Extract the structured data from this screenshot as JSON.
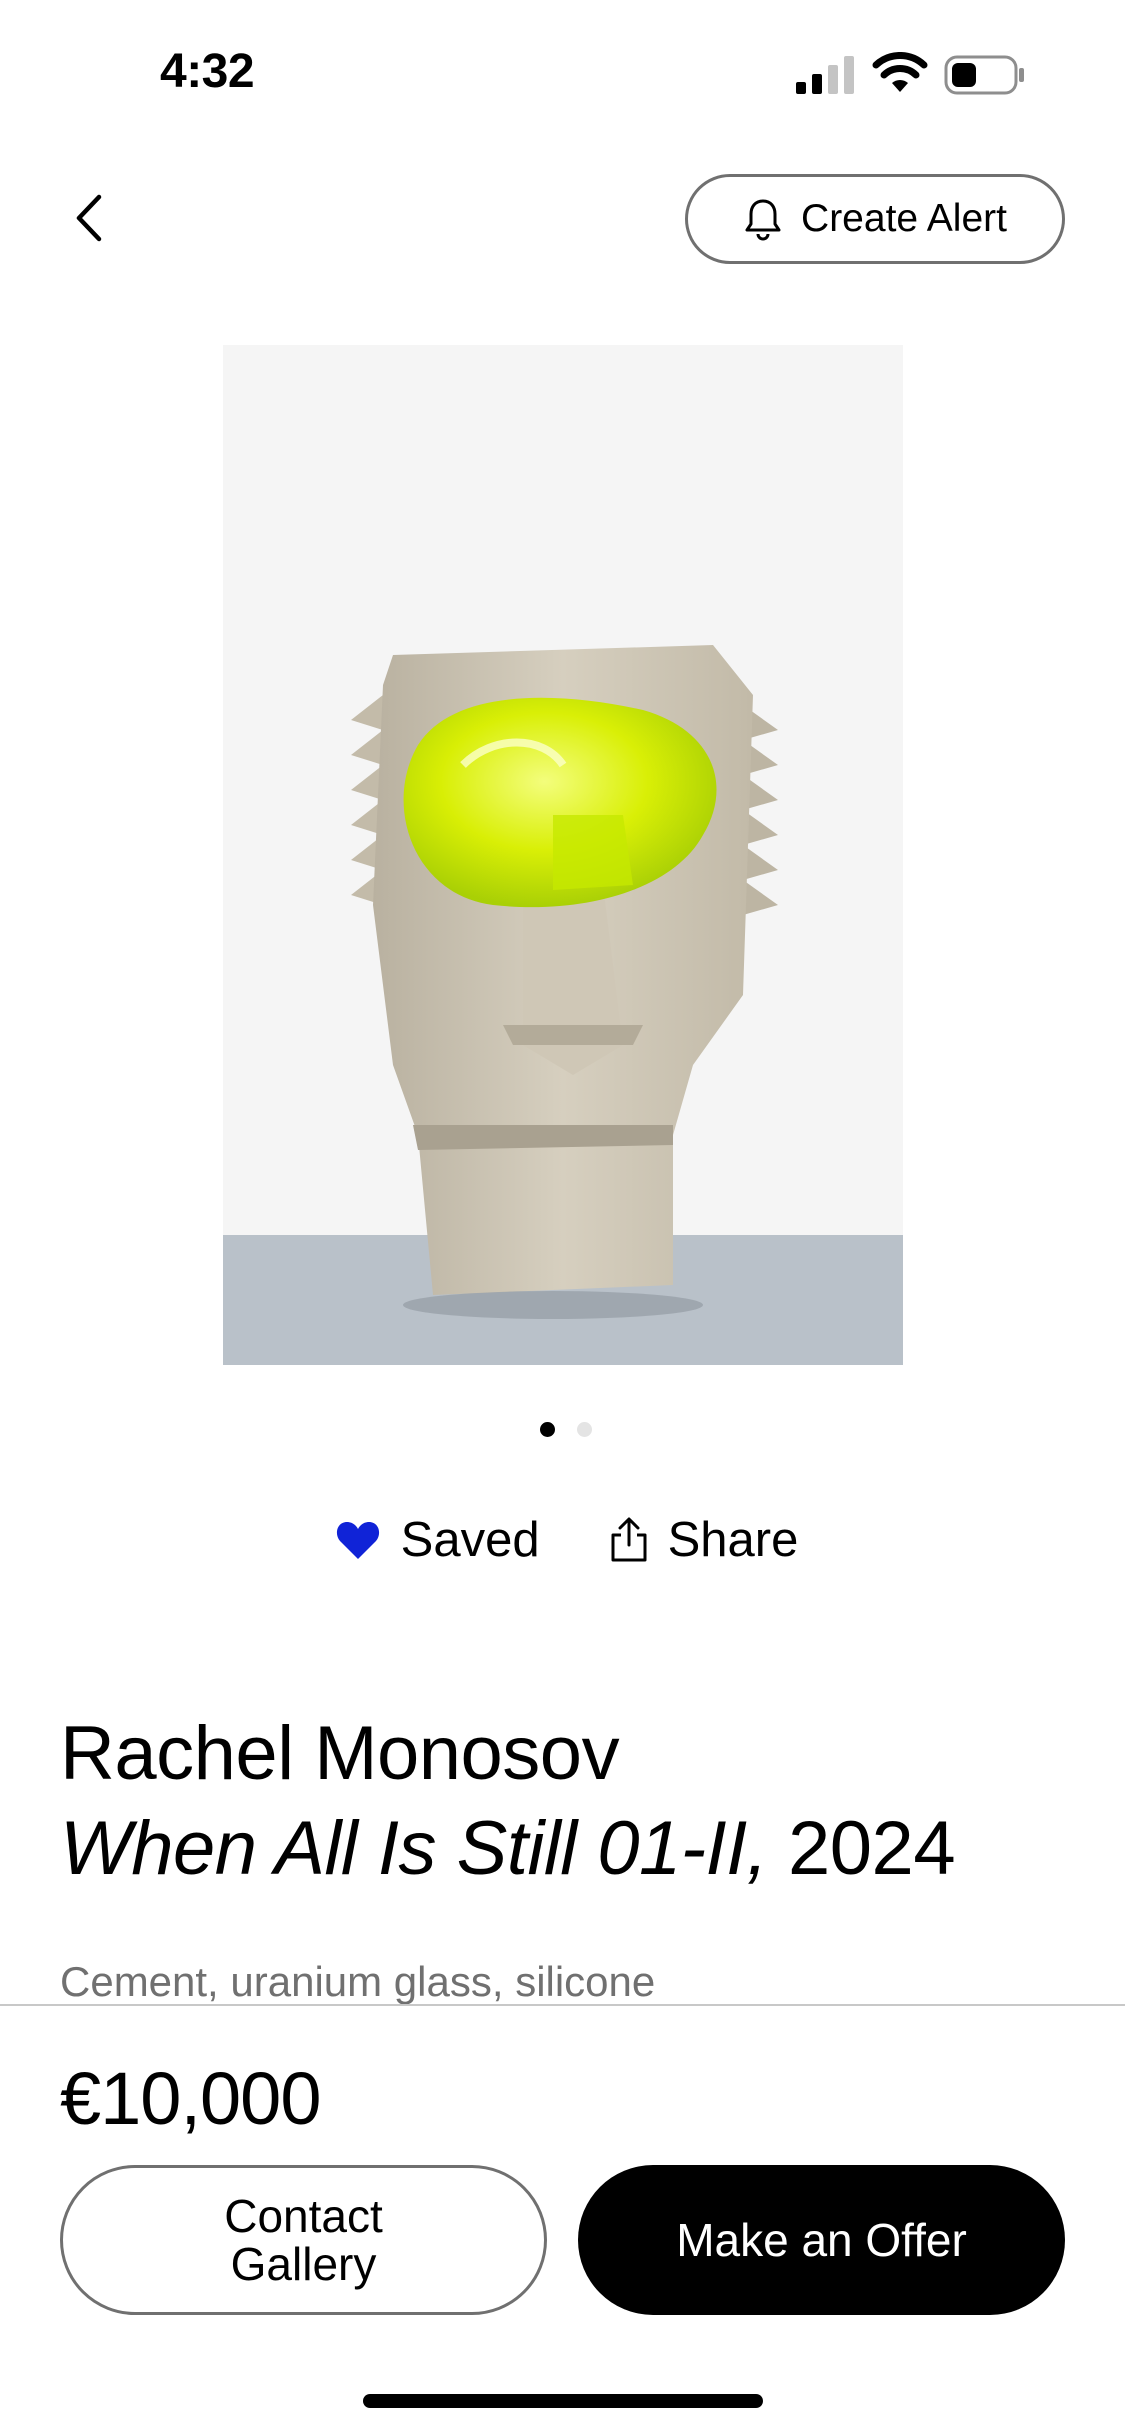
{
  "status_bar": {
    "time": "4:32",
    "signal_icon": "cellular-signal-icon",
    "wifi_icon": "wifi-icon",
    "battery_icon": "battery-icon"
  },
  "nav": {
    "back_icon": "chevron-left-icon",
    "create_alert_label": "Create Alert",
    "bell_icon": "bell-icon"
  },
  "artwork": {
    "image_description_icon": "sculpture-image",
    "pager": {
      "count": 2,
      "active_index": 0
    }
  },
  "actions": {
    "saved_label": "Saved",
    "saved_icon": "heart-filled-icon",
    "saved_color": "#1023D7",
    "share_label": "Share",
    "share_icon": "share-icon"
  },
  "info": {
    "artist": "Rachel Monosov",
    "title": "When All Is Still 01-II,",
    "year": " 2024",
    "medium": "Cement, uranium glass, silicone"
  },
  "purchase": {
    "price": "€10,000",
    "contact_label": "Contact Gallery",
    "offer_label": "Make an Offer"
  }
}
